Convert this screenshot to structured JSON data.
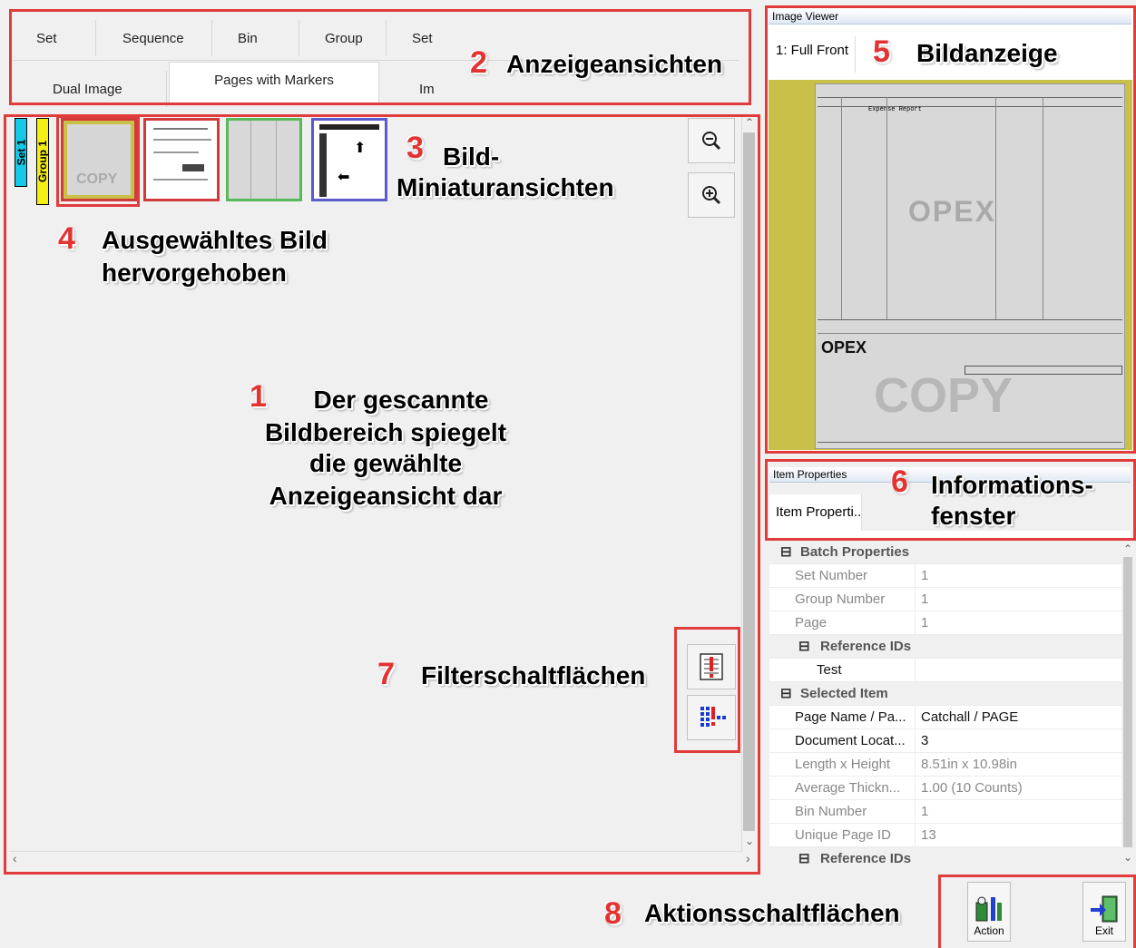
{
  "tabs": {
    "row1": [
      "Set",
      "Sequence",
      "Bin",
      "Group",
      "Set"
    ],
    "row2": [
      "Dual Image",
      "Pages with Markers",
      "Im"
    ]
  },
  "annotations": {
    "n1": "1",
    "t1_l1": "Der gescannte",
    "t1_l2": "Bildbereich spiegelt",
    "t1_l3": "die gewählte",
    "t1_l4": "Anzeigeansicht dar",
    "n2": "2",
    "t2": "Anzeigeansichten",
    "n3": "3",
    "t3_l1": "Bild-",
    "t3_l2": "Miniaturansichten",
    "n4": "4",
    "t4_l1": "Ausgewähltes Bild",
    "t4_l2": "hervorgehoben",
    "n5": "5",
    "t5": "Bildanzeige",
    "n6": "6",
    "t6_l1": "Informations-",
    "t6_l2": "fenster",
    "n7": "7",
    "t7": "Filterschaltflächen",
    "n8": "8",
    "t8": "Aktionsschaltflächen"
  },
  "thumbnails": {
    "set_tag": "Set 1",
    "group_tag": "Group 1",
    "items": [
      {
        "border": "#d23a3a",
        "text": "COPY"
      },
      {
        "border": "#d23a3a"
      },
      {
        "border": "#58b85a"
      },
      {
        "border": "#5a5acb"
      }
    ]
  },
  "image_viewer": {
    "title": "Image Viewer",
    "tab": "1: Full Front",
    "doc": {
      "logo": "OPEX",
      "watermark": "COPY",
      "bottom_logo": "OPEX",
      "line_text": "Expense Report"
    }
  },
  "item_properties": {
    "title": "Item Properties",
    "tab": "Item Properti..",
    "rows": [
      {
        "key": "Batch Properties",
        "value": "",
        "type": "category",
        "expander": "⊟"
      },
      {
        "key": "Set Number",
        "value": "1",
        "type": "gray"
      },
      {
        "key": "Group Number",
        "value": "1",
        "type": "gray"
      },
      {
        "key": "Page",
        "value": "1",
        "type": "gray"
      },
      {
        "key": "Reference IDs",
        "value": "",
        "type": "subcategory",
        "expander": "⊟"
      },
      {
        "key": "Test",
        "value": "",
        "type": "dark-indent"
      },
      {
        "key": "Selected Item",
        "value": "",
        "type": "category",
        "expander": "⊟"
      },
      {
        "key": "Page Name / Pa...",
        "value": "Catchall / PAGE",
        "type": "dark"
      },
      {
        "key": "Document Locat...",
        "value": "3",
        "type": "dark"
      },
      {
        "key": "Length x Height",
        "value": "8.51in x 10.98in",
        "type": "gray"
      },
      {
        "key": "Average Thickn...",
        "value": "1.00 (10 Counts)",
        "type": "gray"
      },
      {
        "key": "Bin Number",
        "value": "1",
        "type": "gray"
      },
      {
        "key": "Unique Page ID",
        "value": "13",
        "type": "gray"
      },
      {
        "key": "Reference IDs",
        "value": "",
        "type": "subcategory",
        "expander": "⊟"
      }
    ]
  },
  "actions": {
    "action_label": "Action",
    "exit_label": "Exit"
  },
  "icons": {
    "zoom_out": "zoom-out-icon",
    "zoom_in": "zoom-in-icon",
    "filter1": "filter-marked-pages-icon",
    "filter2": "filter-grid-icon",
    "action": "action-icon",
    "exit": "exit-door-icon"
  },
  "colors": {
    "annotation_red": "#e03c3c",
    "set_tag": "#14c8e6",
    "group_tag": "#f5ef14",
    "viewer_bg": "#c8c048"
  }
}
